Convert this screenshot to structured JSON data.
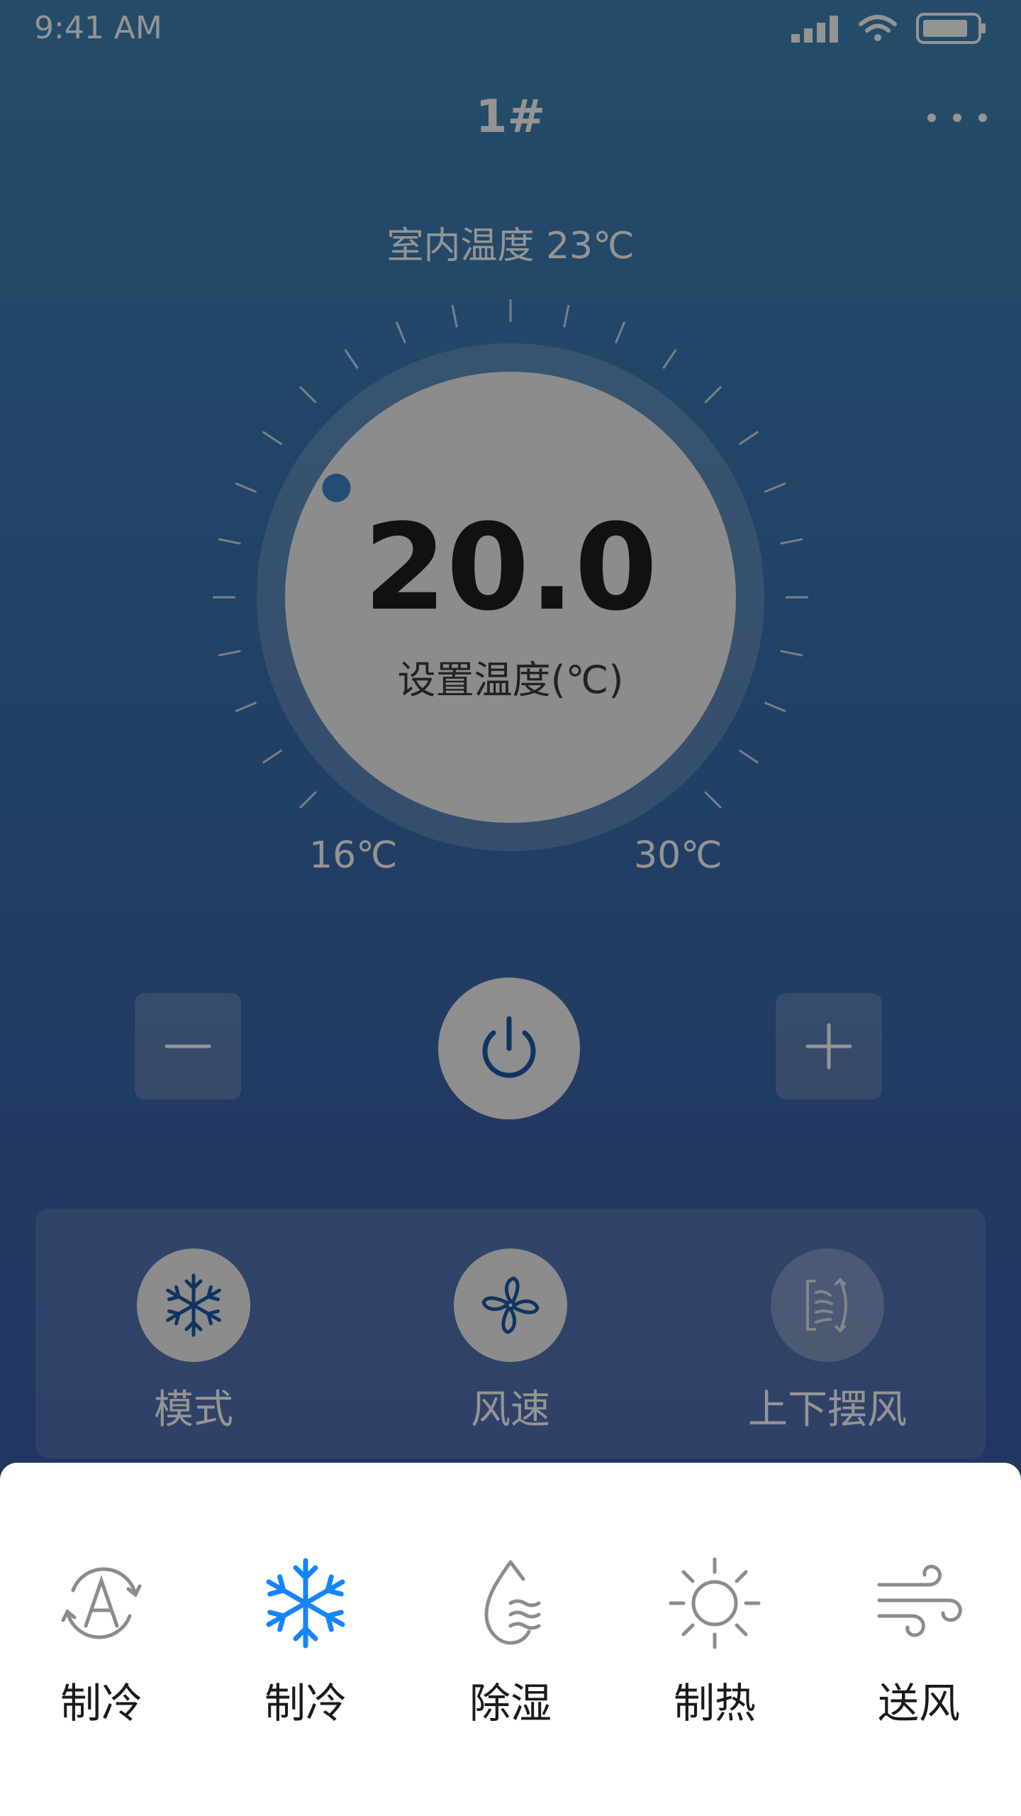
{
  "status_bar": {
    "time": "9:41 AM",
    "icons": [
      "signal-icon",
      "wifi-icon",
      "battery-icon"
    ]
  },
  "header": {
    "title": "1#",
    "more_icon": "more-horizontal-icon"
  },
  "indoor": {
    "label": "室内温度 23℃"
  },
  "dial": {
    "set_temp": "20.0",
    "set_temp_label": "设置温度(℃)",
    "min_label": "16℃",
    "max_label": "30℃",
    "setpoint": 20,
    "min": 16,
    "max": 30
  },
  "controls": {
    "minus_icon": "minus-icon",
    "power_icon": "power-icon",
    "plus_icon": "plus-icon"
  },
  "functions": [
    {
      "label": "模式",
      "icon": "snowflake-icon",
      "active": true
    },
    {
      "label": "风速",
      "icon": "fan-icon",
      "active": true
    },
    {
      "label": "上下摆风",
      "icon": "swing-icon",
      "active": false
    }
  ],
  "mode_sheet": {
    "options": [
      {
        "label": "制冷",
        "icon": "auto-mode-icon",
        "selected": false
      },
      {
        "label": "制冷",
        "icon": "snowflake-icon",
        "selected": true
      },
      {
        "label": "除湿",
        "icon": "droplet-icon",
        "selected": false
      },
      {
        "label": "制热",
        "icon": "sun-icon",
        "selected": false
      },
      {
        "label": "送风",
        "icon": "wind-icon",
        "selected": false
      }
    ]
  },
  "colors": {
    "accent": "#1684ff",
    "icon_dark_blue": "#1d5aa8",
    "icon_gray": "#8c8c8c"
  }
}
